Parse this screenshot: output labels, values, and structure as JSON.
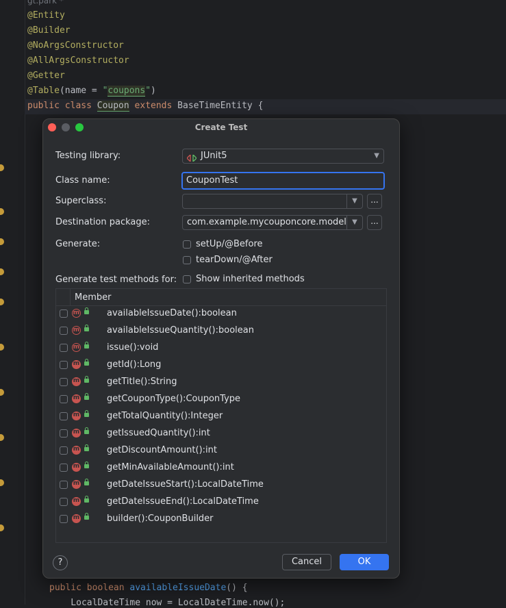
{
  "editor": {
    "tab_hint": "gt.park *",
    "lines": [
      {
        "parts": [
          {
            "t": "@Entity",
            "c": "ann"
          }
        ]
      },
      {
        "parts": [
          {
            "t": "@Builder",
            "c": "ann"
          }
        ]
      },
      {
        "parts": [
          {
            "t": "@NoArgsConstructor",
            "c": "ann"
          }
        ]
      },
      {
        "parts": [
          {
            "t": "@AllArgsConstructor",
            "c": "ann"
          }
        ]
      },
      {
        "parts": [
          {
            "t": "@Getter",
            "c": "ann"
          }
        ]
      },
      {
        "parts": [
          {
            "t": "@Table",
            "c": "ann"
          },
          {
            "t": "(name = ",
            "c": ""
          },
          {
            "t": "\"",
            "c": "str"
          },
          {
            "t": "coupons",
            "c": "str hl"
          },
          {
            "t": "\"",
            "c": "str"
          },
          {
            "t": ")",
            "c": ""
          }
        ]
      },
      {
        "parts": [
          {
            "t": "public class ",
            "c": "kw"
          },
          {
            "t": "Coupon",
            "c": "hl"
          },
          {
            "t": " extends ",
            "c": "kw"
          },
          {
            "t": "BaseTimeEntity {",
            "c": ""
          }
        ]
      }
    ],
    "bottom_lines": [
      {
        "parts": [
          {
            "t": "public boolean ",
            "c": "kw"
          },
          {
            "t": "availableIssueDate",
            "c": "fn"
          },
          {
            "t": "() {",
            "c": ""
          }
        ]
      },
      {
        "parts": [
          {
            "t": "    LocalDateTime now = LocalDateTime.now();",
            "c": ""
          }
        ]
      }
    ]
  },
  "dialog": {
    "title": "Create Test",
    "testing_library_label": "Testing library:",
    "testing_library_value": "JUnit5",
    "class_name_label": "Class name:",
    "class_name_value": "CouponTest",
    "superclass_label": "Superclass:",
    "superclass_value": "",
    "destination_label": "Destination package:",
    "destination_value": "com.example.mycouponcore.model",
    "generate_label": "Generate:",
    "setup_label": "setUp/@Before",
    "teardown_label": "tearDown/@After",
    "methods_label": "Generate test methods for:",
    "show_inherited_label": "Show inherited methods",
    "more_button": "...",
    "table_header": "Member",
    "members": [
      {
        "name": "availableIssueDate():boolean",
        "icon": "method-icon"
      },
      {
        "name": "availableIssueQuantity():boolean",
        "icon": "method-icon"
      },
      {
        "name": "issue():void",
        "icon": "method-icon"
      },
      {
        "name": "getId():Long",
        "icon": "getter-method-icon"
      },
      {
        "name": "getTitle():String",
        "icon": "getter-method-icon"
      },
      {
        "name": "getCouponType():CouponType",
        "icon": "getter-method-icon"
      },
      {
        "name": "getTotalQuantity():Integer",
        "icon": "getter-method-icon"
      },
      {
        "name": "getIssuedQuantity():int",
        "icon": "getter-method-icon"
      },
      {
        "name": "getDiscountAmount():int",
        "icon": "getter-method-icon"
      },
      {
        "name": "getMinAvailableAmount():int",
        "icon": "getter-method-icon"
      },
      {
        "name": "getDateIssueStart():LocalDateTime",
        "icon": "getter-method-icon"
      },
      {
        "name": "getDateIssueEnd():LocalDateTime",
        "icon": "getter-method-icon"
      },
      {
        "name": "builder():CouponBuilder",
        "icon": "getter-method-icon"
      }
    ],
    "help_label": "?",
    "cancel_label": "Cancel",
    "ok_label": "OK"
  },
  "colors": {
    "accent": "#3574f0",
    "close": "#ff5f57",
    "minimize_inactive": "#5a5d63",
    "zoom": "#28c840"
  }
}
